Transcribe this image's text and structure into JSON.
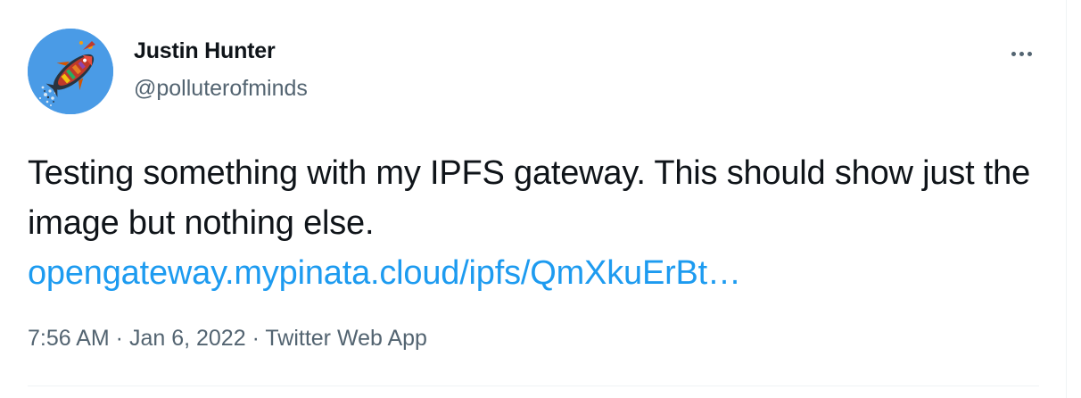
{
  "author": {
    "display_name": "Justin Hunter",
    "handle": "@polluterofminds",
    "avatar_icon": "rocket-fish-avatar"
  },
  "tweet": {
    "text": "Testing something with my IPFS gateway. This should show just the image but nothing else.",
    "link_text": "opengateway.mypinata.cloud/ipfs/QmXkuErBt…"
  },
  "meta": {
    "time": "7:56 AM",
    "separator": " · ",
    "date": "Jan 6, 2022",
    "source": "Twitter Web App"
  },
  "colors": {
    "link": "#1d9bf0",
    "secondary_text": "#536471",
    "primary_text": "#0f1419",
    "avatar_bg": "#4a9be6"
  }
}
